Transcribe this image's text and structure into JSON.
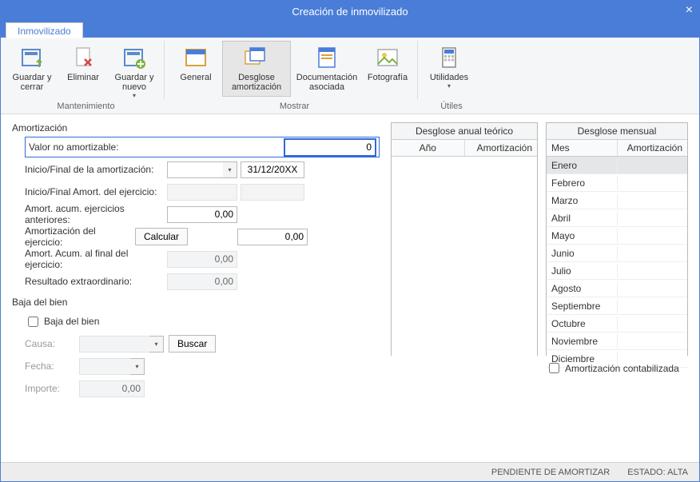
{
  "title": "Creación de inmovilizado",
  "tab": "Inmovilizado",
  "ribbon": {
    "mantenimiento": {
      "label": "Mantenimiento",
      "guardar_cerrar": "Guardar y cerrar",
      "eliminar": "Eliminar",
      "guardar_nuevo": "Guardar y nuevo"
    },
    "mostrar": {
      "label": "Mostrar",
      "general": "General",
      "desglose": "Desglose amortización",
      "documentacion": "Documentación asociada",
      "fotografia": "Fotografía"
    },
    "utiles": {
      "label": "Útiles",
      "utilidades": "Utilidades"
    }
  },
  "amortizacion": {
    "heading": "Amortización",
    "valor_no_amortizable_label": "Valor no amortizable:",
    "valor_no_amortizable": "0",
    "inicio_final_label": "Inicio/Final de la amortización:",
    "inicio": "",
    "final": "31/12/20XX",
    "inicio_final_ej_label": "Inicio/Final Amort. del ejercicio:",
    "inicio_ej": "",
    "final_ej": "",
    "acum_anterior_label": "Amort. acum. ejercicios anteriores:",
    "acum_anterior": "0,00",
    "ejercicio_label": "Amortización del ejercicio:",
    "calcular": "Calcular",
    "ejercicio": "0,00",
    "acum_final_label": "Amort. Acum. al final del ejercicio:",
    "acum_final": "0,00",
    "resultado_label": "Resultado extraordinario:",
    "resultado": "0,00"
  },
  "baja": {
    "heading": "Baja del bien",
    "checkbox": "Baja del bien",
    "causa_label": "Causa:",
    "causa": "",
    "buscar": "Buscar",
    "fecha_label": "Fecha:",
    "fecha": "",
    "importe_label": "Importe:",
    "importe": "0,00"
  },
  "grid_anual": {
    "title": "Desglose anual teórico",
    "col_ano": "Año",
    "col_amort": "Amortización"
  },
  "grid_mensual": {
    "title": "Desglose mensual",
    "col_mes": "Mes",
    "col_amort": "Amortización",
    "meses": [
      "Enero",
      "Febrero",
      "Marzo",
      "Abril",
      "Mayo",
      "Junio",
      "Julio",
      "Agosto",
      "Septiembre",
      "Octubre",
      "Noviembre",
      "Diciembre"
    ],
    "contabilizada": "Amortización contabilizada"
  },
  "status": {
    "pendiente": "PENDIENTE DE AMORTIZAR",
    "estado": "ESTADO: ALTA"
  }
}
